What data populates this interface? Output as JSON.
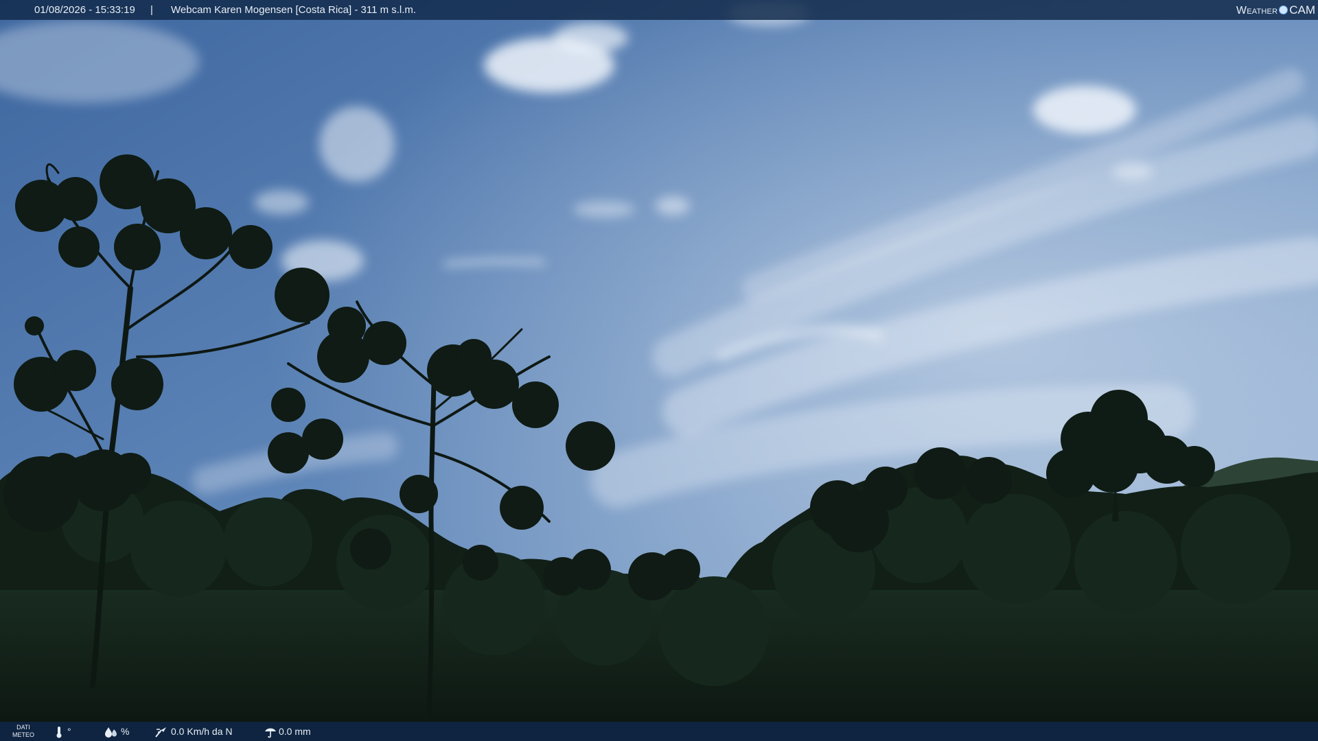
{
  "header": {
    "timestamp": "01/08/2026 - 15:33:19",
    "separator": "|",
    "camera_title": "Webcam Karen Mogensen [Costa Rica]  - 311 m s.l.m."
  },
  "brand": {
    "word": "Weather",
    "suffix": "CAM"
  },
  "weather": {
    "label_line1": "DATI",
    "label_line2": "METEO",
    "temperature": "°",
    "humidity": "%",
    "wind": "0.0 Km/h da N",
    "rain": "0.0 mm",
    "icons": [
      "thermometer-icon",
      "humidity-icon",
      "wind-icon",
      "rain-icon"
    ]
  },
  "colors": {
    "sky_top": "#4a73a9",
    "sky_bottom": "#9bb7d6",
    "foliage": "#0f1e16",
    "bar": "#10284a"
  }
}
